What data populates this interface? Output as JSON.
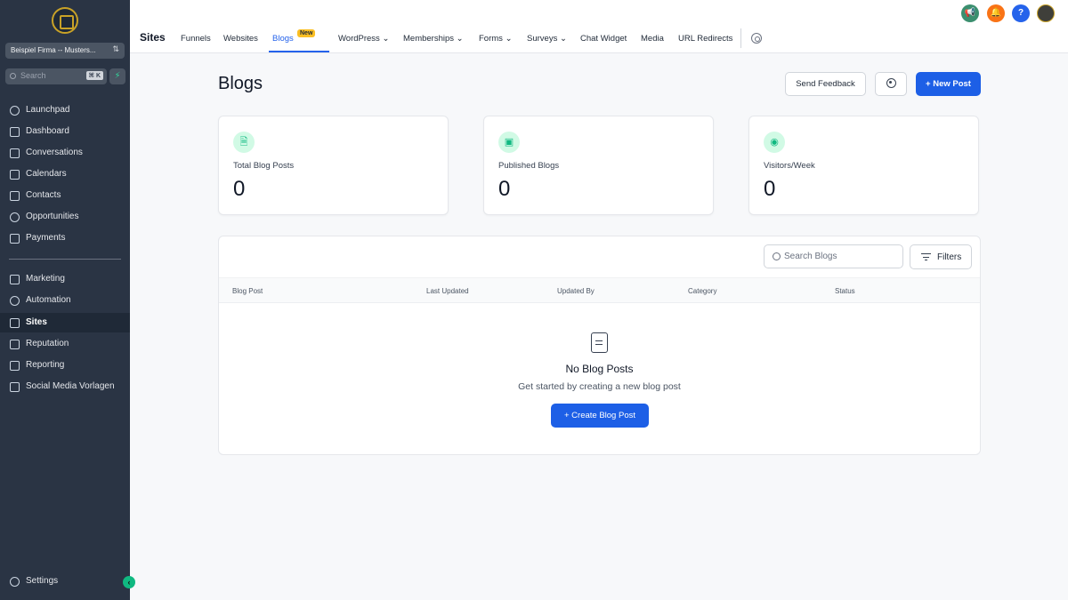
{
  "sidebar": {
    "account_name": "Beispiel Firma -- Musters...",
    "search_placeholder": "Search",
    "search_shortcut": "⌘ K",
    "items_primary": [
      {
        "label": "Launchpad",
        "icon": "rocket-icon"
      },
      {
        "label": "Dashboard",
        "icon": "dashboard-icon"
      },
      {
        "label": "Conversations",
        "icon": "chat-icon"
      },
      {
        "label": "Calendars",
        "icon": "calendar-icon"
      },
      {
        "label": "Contacts",
        "icon": "contacts-icon"
      },
      {
        "label": "Opportunities",
        "icon": "opportunities-icon"
      },
      {
        "label": "Payments",
        "icon": "payments-icon"
      }
    ],
    "items_secondary": [
      {
        "label": "Marketing",
        "icon": "send-icon"
      },
      {
        "label": "Automation",
        "icon": "automation-icon"
      },
      {
        "label": "Sites",
        "icon": "sites-icon",
        "active": true
      },
      {
        "label": "Reputation",
        "icon": "star-icon"
      },
      {
        "label": "Reporting",
        "icon": "trend-icon"
      },
      {
        "label": "Social Media Vorlagen",
        "icon": "media-icon"
      }
    ],
    "settings_label": "Settings"
  },
  "topnav": {
    "section_title": "Sites",
    "tabs": [
      {
        "label": "Funnels"
      },
      {
        "label": "Websites"
      },
      {
        "label": "Blogs",
        "active": true,
        "badge": "New"
      },
      {
        "label": "WordPress",
        "dropdown": true
      },
      {
        "label": "Memberships",
        "dropdown": true
      },
      {
        "label": "Forms",
        "dropdown": true
      },
      {
        "label": "Surveys",
        "dropdown": true
      },
      {
        "label": "Chat Widget"
      },
      {
        "label": "Media"
      },
      {
        "label": "URL Redirects"
      }
    ],
    "dropdown_glyph": "⌄",
    "actions": [
      {
        "icon": "megaphone-icon",
        "glyph": "📢",
        "color": "#3b8f6f"
      },
      {
        "icon": "bell-icon",
        "glyph": "🔔",
        "color": "#f97316"
      },
      {
        "icon": "help-icon",
        "glyph": "?",
        "color": "#2563eb"
      }
    ]
  },
  "main": {
    "title": "Blogs",
    "send_feedback": "Send Feedback",
    "new_post": "+ New Post",
    "stats": [
      {
        "label": "Total Blog Posts",
        "value": "0",
        "icon": "document-icon",
        "glyph": "🗎"
      },
      {
        "label": "Published Blogs",
        "value": "0",
        "icon": "image-check-icon",
        "glyph": "▣"
      },
      {
        "label": "Visitors/Week",
        "value": "0",
        "icon": "eye-icon",
        "glyph": "◉"
      }
    ],
    "search_placeholder": "Search Blogs",
    "filters_label": "Filters",
    "columns": [
      "Blog Post",
      "Last Updated",
      "Updated By",
      "Category",
      "Status"
    ],
    "empty": {
      "title": "No Blog Posts",
      "subtitle": "Get started by creating a new blog post",
      "button": "+  Create Blog Post"
    }
  },
  "colors": {
    "sidebar_bg": "#2a3444",
    "primary": "#1d5fe6",
    "accent_green": "#10b981",
    "badge": "#fbbf24"
  }
}
